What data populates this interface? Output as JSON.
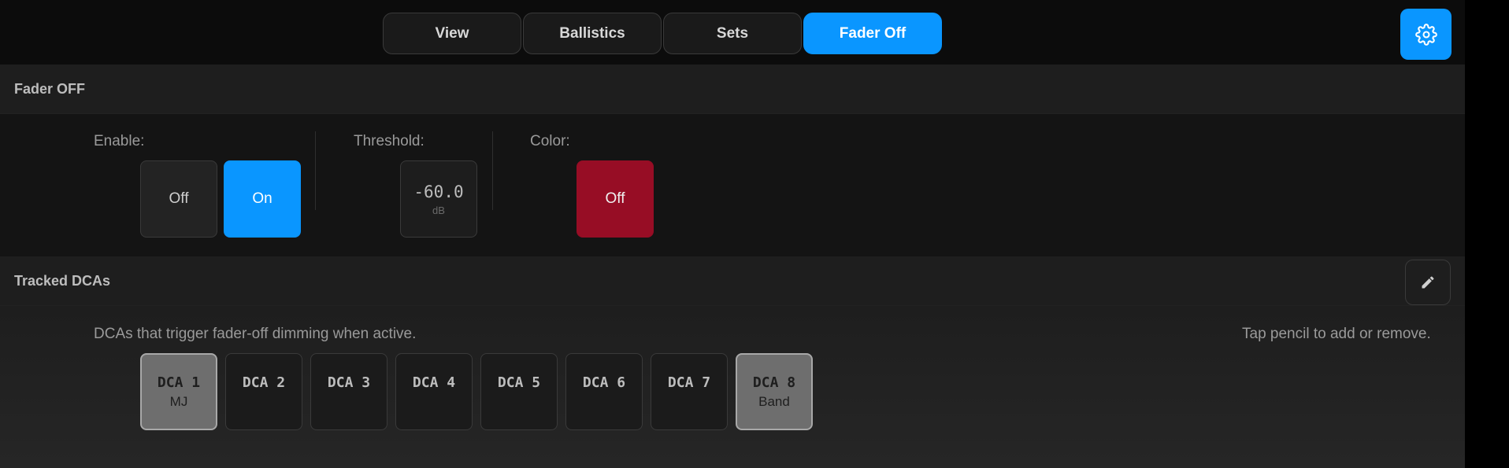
{
  "tabs": [
    {
      "label": "View",
      "active": false
    },
    {
      "label": "Ballistics",
      "active": false
    },
    {
      "label": "Sets",
      "active": false
    },
    {
      "label": "Fader Off",
      "active": true
    }
  ],
  "settings_icon": "gear-icon",
  "fader_off": {
    "title": "Fader OFF",
    "enable_label": "Enable:",
    "enable_off": "Off",
    "enable_on": "On",
    "enable_value": "On",
    "threshold_label": "Threshold:",
    "threshold_value": "-60.0",
    "threshold_unit": "dB",
    "color_label": "Color:",
    "color_value": "Off",
    "color_swatch": "#970d25"
  },
  "tracked_dcas": {
    "title": "Tracked DCAs",
    "edit_icon": "pencil-icon",
    "description": "DCAs that trigger fader-off dimming when active.",
    "hint": "Tap pencil to add or remove.",
    "items": [
      {
        "name": "DCA 1",
        "sub": "MJ",
        "tracked": true
      },
      {
        "name": "DCA 2",
        "sub": "",
        "tracked": false
      },
      {
        "name": "DCA 3",
        "sub": "",
        "tracked": false
      },
      {
        "name": "DCA 4",
        "sub": "",
        "tracked": false
      },
      {
        "name": "DCA 5",
        "sub": "",
        "tracked": false
      },
      {
        "name": "DCA 6",
        "sub": "",
        "tracked": false
      },
      {
        "name": "DCA 7",
        "sub": "",
        "tracked": false
      },
      {
        "name": "DCA 8",
        "sub": "Band",
        "tracked": true
      }
    ]
  },
  "colors": {
    "accent": "#0a96ff",
    "fader_off_color": "#970d25"
  }
}
